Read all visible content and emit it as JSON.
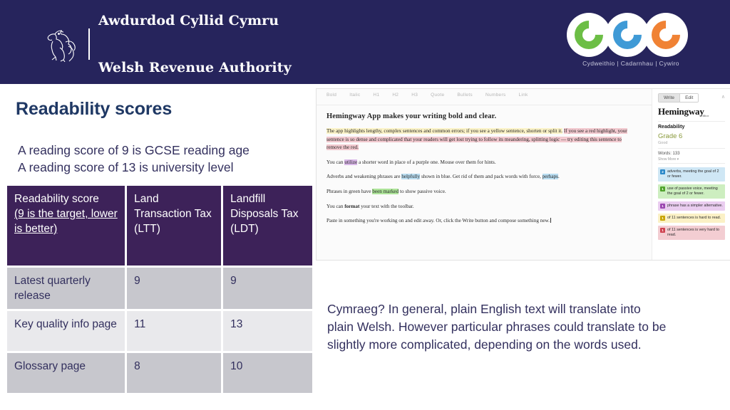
{
  "header": {
    "wra_line1": "Awdurdod Cyllid Cymru",
    "wra_line2": "Welsh Revenue Authority",
    "ccc_tagline": "Cydweithio  |  Cadarnhau  |  Cywiro",
    "ccc_colors": [
      "#6cbe45",
      "#3f9ad6",
      "#f08234"
    ],
    "band_color": "#26245c"
  },
  "slide": {
    "title": "Readability scores",
    "intro_line1": "A reading score of 9 is GCSE reading age",
    "intro_line2": "A reading score of 13 is university level"
  },
  "table": {
    "headers": {
      "label_main": "Readability score",
      "label_note": "(9 is the target, lower is better)",
      "col_ltt": "Land Transaction Tax (LTT)",
      "col_ldt": "Landfill Disposals Tax (LDT)"
    },
    "rows": [
      {
        "label": "Latest quarterly release",
        "ltt": "9",
        "ldt": "9"
      },
      {
        "label": "Key quality info page",
        "ltt": "11",
        "ldt": "13"
      },
      {
        "label": "Glossary page",
        "ltt": "8",
        "ldt": "10"
      }
    ],
    "header_bg": "#3d2259",
    "row_shade_bg": "#c7c7cd",
    "row_light_bg": "#e9e9ec"
  },
  "hemingway": {
    "toolbar": [
      "Bold",
      "Italic",
      "H1",
      "H2",
      "H3",
      "Quote",
      "Bullets",
      "Numbers",
      "Link"
    ],
    "doc": {
      "heading": "Hemingway App makes your writing bold and clear.",
      "p1_yellow": "The app highlights lengthy, complex sentences and common errors; if you see a yellow sentence, shorten or split it.",
      "p1_red": "If you see a red highlight, your sentence is so dense and complicated that your readers will get lost trying to follow its meandering, splitting logic — try editing this sentence to remove the red.",
      "p2_before": "You can ",
      "p2_purple": "utilize",
      "p2_after": " a shorter word in place of a purple one. Mouse over them for hints.",
      "p3_before": "Adverbs and weakening phrases are ",
      "p3_blue1": "helpfully",
      "p3_mid": " shown in blue. Get rid of them and pack words with force, ",
      "p3_blue2": "perhaps",
      "p3_after": ".",
      "p4_before": "Phrases in green have ",
      "p4_green": "been marked",
      "p4_after": " to show passive voice.",
      "p5_before": "You can ",
      "p5_bold": "format",
      "p5_after": " your text with the toolbar.",
      "p6": "Paste in something you're working on and edit away. Or, click the Write button and compose something new."
    },
    "sidebar": {
      "mode_write": "Write",
      "mode_edit": "Edit",
      "collapse_icon": "∧",
      "brand": "Hemingway",
      "brand_sub": "Editor",
      "readability_label": "Readability",
      "grade": "Grade 6",
      "grade_note": "Good",
      "words": "Words: 133",
      "show_more": "Show More ▾",
      "stats": [
        {
          "count": "2",
          "text": "adverbs, meeting the goal of 2 or fewer.",
          "style": "stat-blue"
        },
        {
          "count": "1",
          "text": "use of passive voice, meeting the goal of 2 or fewer.",
          "style": "stat-green"
        },
        {
          "count": "1",
          "text": "phrase has a simpler alternative.",
          "style": "stat-purple"
        },
        {
          "count": "1",
          "text": "of 11 sentences is hard to read.",
          "style": "stat-yellow"
        },
        {
          "count": "1",
          "text": "of 11 sentences is very hard to read.",
          "style": "stat-red"
        }
      ]
    }
  },
  "cymraeg_note": {
    "line1": "Cymraeg? In general, plain English text will translate into",
    "line2": "plain Welsh. However particular phrases could translate to be",
    "line3": "slightly more complicated, depending on the words used."
  }
}
